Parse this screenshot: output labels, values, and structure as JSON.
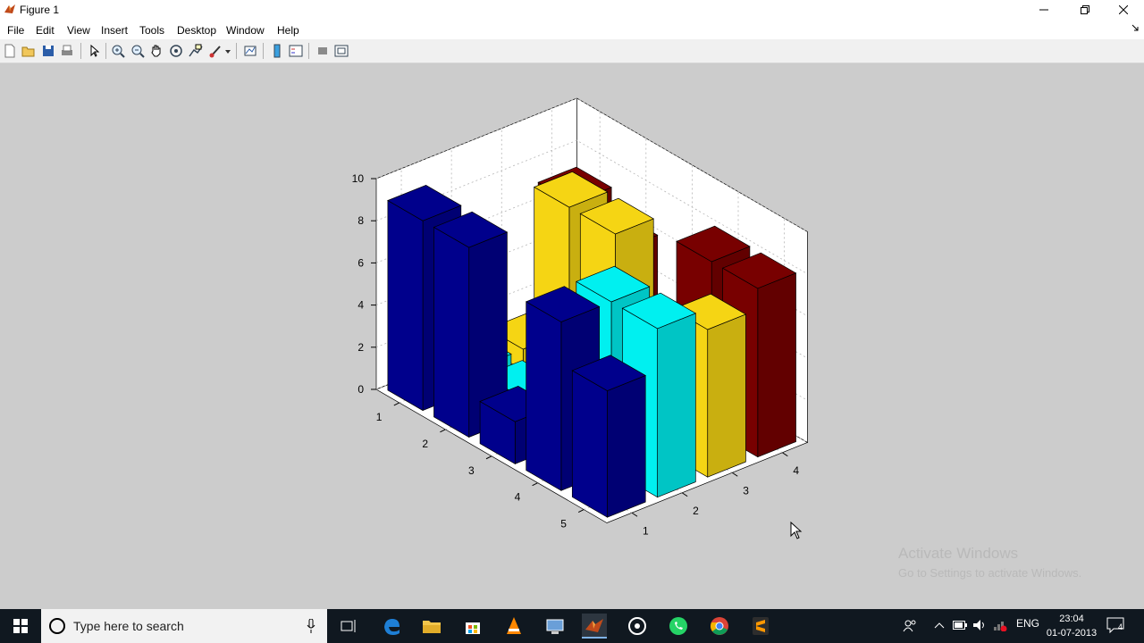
{
  "window": {
    "title": "Figure 1",
    "minimize_icon": "minimize-icon",
    "maximize_icon": "restore-icon",
    "close_icon": "close-icon"
  },
  "menu": {
    "items": [
      "File",
      "Edit",
      "View",
      "Insert",
      "Tools",
      "Desktop",
      "Window",
      "Help"
    ]
  },
  "toolbar": {
    "icons": [
      "new-figure-icon",
      "open-file-icon",
      "save-icon",
      "print-icon",
      "select-arrow-icon",
      "zoom-in-icon",
      "zoom-out-icon",
      "pan-hand-icon",
      "rotate-3d-icon",
      "data-cursor-icon",
      "brush-icon",
      "link-plot-icon",
      "colorbar-icon",
      "legend-icon",
      "hide-plot-tools-icon",
      "show-plot-tools-icon"
    ]
  },
  "chart_data": {
    "type": "bar3",
    "title": "",
    "xlabel": "",
    "ylabel": "",
    "zlabel": "",
    "zlim": [
      0,
      10
    ],
    "z_ticks": [
      "0",
      "2",
      "4",
      "6",
      "8",
      "10"
    ],
    "row_ticks": [
      "1",
      "2",
      "3",
      "4",
      "5"
    ],
    "column_ticks": [
      "1",
      "2",
      "3",
      "4"
    ],
    "grid": true,
    "colors": [
      "#00008c",
      "#00f0f0",
      "#f5d514",
      "#780000"
    ],
    "series": [
      {
        "column": 1,
        "color": "#00008c",
        "values": [
          9,
          9,
          2,
          8,
          6
        ]
      },
      {
        "column": 2,
        "color": "#00f0f0",
        "values": [
          1,
          1,
          1,
          8,
          8
        ]
      },
      {
        "column": 3,
        "color": "#f5d514",
        "values": [
          1,
          9,
          9,
          2,
          7
        ]
      },
      {
        "column": 4,
        "color": "#780000",
        "values": [
          7,
          6,
          2,
          8,
          8
        ]
      }
    ]
  },
  "watermark": {
    "line1": "Activate Windows",
    "line2": "Go to Settings to activate Windows."
  },
  "taskbar": {
    "search_placeholder": "Type here to search",
    "apps": [
      "task-view-icon",
      "edge-icon",
      "file-explorer-icon",
      "store-icon",
      "vlc-icon",
      "network-app-icon",
      "matlab-icon",
      "media-icon",
      "whatsapp-icon",
      "chrome-icon",
      "sublime-icon"
    ],
    "tray_language": "ENG",
    "time": "23:04",
    "date": "01-07-2013",
    "notification_count": "4"
  }
}
